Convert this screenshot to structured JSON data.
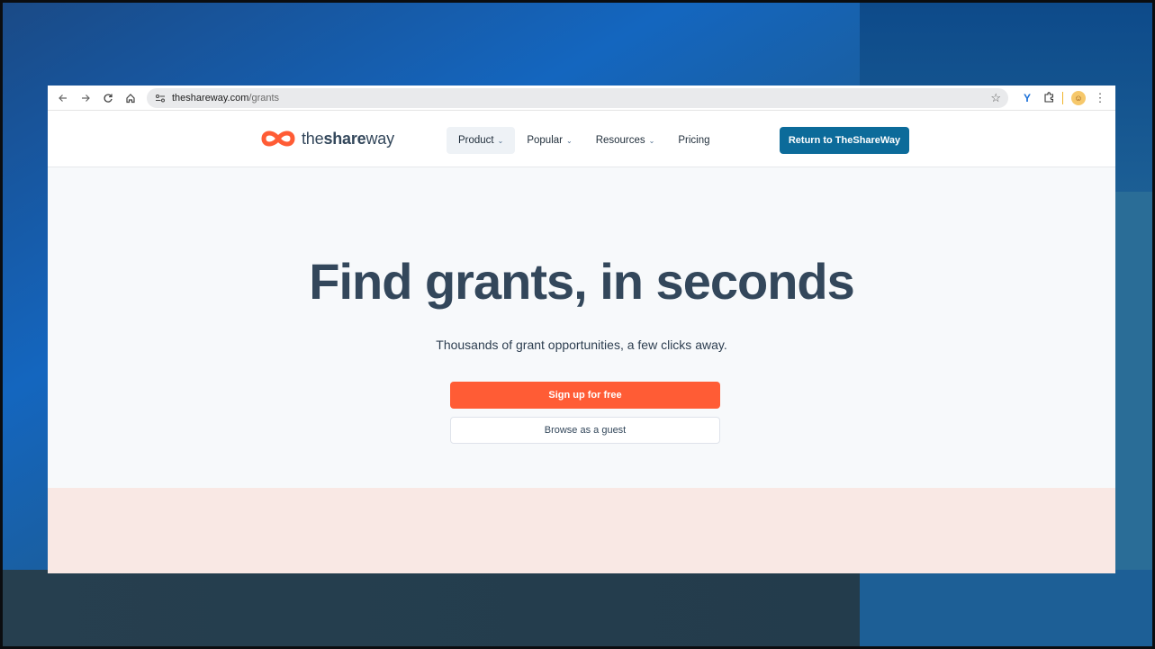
{
  "browser": {
    "url_host": "theshareway.com",
    "url_path": "/grants",
    "icons": {
      "back": "arrow-left-icon",
      "forward": "arrow-right-icon",
      "reload": "reload-icon",
      "home": "home-icon",
      "site_info": "site-settings-icon",
      "bookmark": "star-icon",
      "extension_1": "v-extension-icon",
      "extensions": "puzzle-icon",
      "profile": "avatar",
      "menu": "kebab-menu-icon"
    }
  },
  "site": {
    "logo_prefix": "the",
    "logo_bold": "share",
    "logo_suffix": "way",
    "brand_color": "#ff5c35",
    "nav": [
      {
        "label": "Product",
        "chevron": "⌄"
      },
      {
        "label": "Popular",
        "chevron": "⌄"
      },
      {
        "label": "Resources",
        "chevron": "⌄"
      },
      {
        "label": "Pricing"
      }
    ],
    "return_button": "Return to TheShareWay",
    "return_color": "#0c6b9a"
  },
  "hero": {
    "title": "Find grants, in seconds",
    "subtitle": "Thousands of grant opportunities, a few clicks away.",
    "signup_button": "Sign up for free",
    "guest_button": "Browse as a guest"
  }
}
